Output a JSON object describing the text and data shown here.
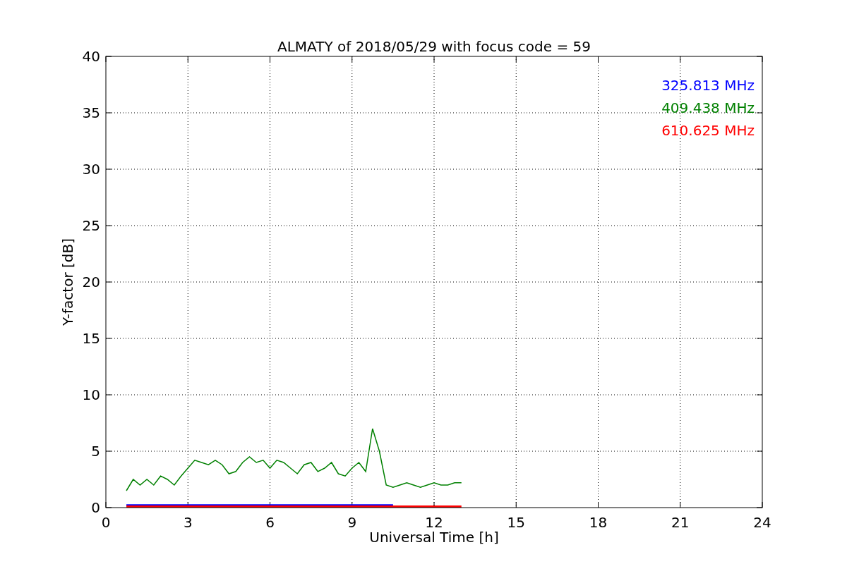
{
  "chart": {
    "chart_data": {
      "type": "line",
      "title": "ALMATY of 2018/05/29 with focus code = 59",
      "xlabel": "Universal Time [h]",
      "ylabel": "Y-factor [dB]",
      "xlim": [
        0,
        24
      ],
      "ylim": [
        0,
        40
      ],
      "xticks": [
        0,
        3,
        6,
        9,
        12,
        15,
        18,
        21,
        24
      ],
      "yticks": [
        0,
        5,
        10,
        15,
        20,
        25,
        30,
        35,
        40
      ],
      "grid": true,
      "x": [
        0.75,
        1.0,
        1.25,
        1.5,
        1.75,
        2.0,
        2.25,
        2.5,
        2.75,
        3.0,
        3.25,
        3.5,
        3.75,
        4.0,
        4.25,
        4.5,
        4.75,
        5.0,
        5.25,
        5.5,
        5.75,
        6.0,
        6.25,
        6.5,
        6.75,
        7.0,
        7.25,
        7.5,
        7.75,
        8.0,
        8.25,
        8.5,
        8.75,
        9.0,
        9.25,
        9.5,
        9.75,
        10.0,
        10.25,
        10.5,
        10.75,
        11.0,
        11.25,
        11.5,
        11.75,
        12.0,
        12.25,
        12.5,
        12.75,
        13.0
      ],
      "series": [
        {
          "name": "325.813 MHz",
          "color": "#0000ff",
          "values": [
            0.2,
            0.2,
            0.2,
            0.2,
            0.2,
            0.2,
            0.2,
            0.2,
            0.2,
            0.2,
            0.2,
            0.2,
            0.2,
            0.2,
            0.2,
            0.2,
            0.2,
            0.2,
            0.2,
            0.2,
            0.2,
            0.2,
            0.2,
            0.2,
            0.2,
            0.2,
            0.2,
            0.2,
            0.2,
            0.2,
            0.2,
            0.2,
            0.2,
            0.2,
            0.2,
            0.2,
            0.2,
            0.2,
            0.2,
            0.2,
            null,
            null,
            null,
            null,
            null,
            null,
            null,
            null,
            null,
            null
          ]
        },
        {
          "name": "409.438 MHz",
          "color": "#008000",
          "values": [
            1.5,
            2.5,
            2.0,
            2.5,
            2.0,
            2.8,
            2.5,
            2.0,
            2.8,
            3.5,
            4.2,
            4.0,
            3.8,
            4.2,
            3.8,
            3.0,
            3.2,
            4.0,
            4.5,
            4.0,
            4.2,
            3.5,
            4.2,
            4.0,
            3.5,
            3.0,
            3.8,
            4.0,
            3.2,
            3.5,
            4.0,
            3.0,
            2.8,
            3.5,
            4.0,
            3.2,
            7.0,
            5.0,
            2.0,
            1.8,
            2.0,
            2.2,
            2.0,
            1.8,
            2.0,
            2.2,
            2.0,
            2.0,
            2.2,
            2.2
          ]
        },
        {
          "name": "610.625 MHz",
          "color": "#ff0000",
          "values": [
            0.1,
            0.1,
            0.1,
            0.1,
            0.1,
            0.1,
            0.1,
            0.1,
            0.1,
            0.1,
            0.1,
            0.1,
            0.1,
            0.1,
            0.1,
            0.1,
            0.1,
            0.1,
            0.1,
            0.1,
            0.1,
            0.1,
            0.1,
            0.1,
            0.1,
            0.1,
            0.1,
            0.1,
            0.1,
            0.1,
            0.1,
            0.1,
            0.1,
            0.1,
            0.1,
            0.1,
            0.1,
            0.1,
            0.1,
            0.1,
            0.1,
            0.1,
            0.1,
            0.1,
            0.1,
            0.1,
            0.1,
            0.1,
            0.1,
            0.1
          ]
        }
      ]
    }
  }
}
